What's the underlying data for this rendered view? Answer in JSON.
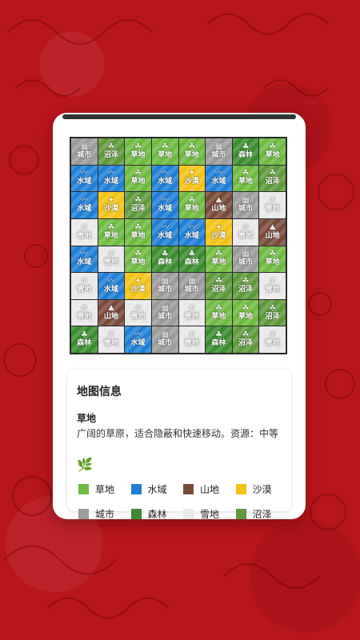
{
  "tile_names": {
    "grass": "草地",
    "water": "水域",
    "mount": "山地",
    "desert": "沙漠",
    "city": "城市",
    "forest": "森林",
    "snow": "雪地",
    "swamp": "沼泽"
  },
  "tile_icons": {
    "grass": "☘",
    "water": "〰",
    "mount": "⛰",
    "desert": "✦",
    "city": "▦",
    "forest": "♣",
    "snow": "❄",
    "swamp": "☘"
  },
  "tile_colors": {
    "grass": "#6fbb3f",
    "water": "#1f7fd6",
    "mount": "#7a4a38",
    "desert": "#f3c314",
    "city": "#9b9b9b",
    "forest": "#3a8d2e",
    "snow": "#e9e9e9",
    "swamp": "#5e9a3a"
  },
  "board": [
    [
      "city",
      "swamp",
      "grass",
      "grass",
      "grass",
      "city",
      "forest",
      "grass"
    ],
    [
      "water",
      "water",
      "grass",
      "water",
      "desert",
      "water",
      "grass",
      "swamp"
    ],
    [
      "water",
      "desert",
      "swamp",
      "water",
      "grass",
      "mount",
      "city",
      "snow"
    ],
    [
      "snow",
      "grass",
      "grass",
      "water",
      "water",
      "desert",
      "snow",
      "mount"
    ],
    [
      "water",
      "snow",
      "grass",
      "forest",
      "forest",
      "grass",
      "city",
      "grass"
    ],
    [
      "snow",
      "water",
      "desert",
      "city",
      "city",
      "swamp",
      "swamp",
      "snow"
    ],
    [
      "snow",
      "mount",
      "snow",
      "city",
      "snow",
      "grass",
      "grass",
      "swamp"
    ],
    [
      "forest",
      "snow",
      "water",
      "city",
      "snow",
      "forest",
      "swamp",
      "snow"
    ]
  ],
  "info": {
    "title": "地图信息",
    "selected_name": "草地",
    "selected_desc": "广阔的草原，适合隐蔽和快速移动。资源：中等",
    "selected_icon": "🌿"
  },
  "legend": [
    {
      "key": "grass",
      "label": "草地",
      "color": "#6fbb3f"
    },
    {
      "key": "water",
      "label": "水域",
      "color": "#1f7fd6"
    },
    {
      "key": "mount",
      "label": "山地",
      "color": "#7a4a38"
    },
    {
      "key": "desert",
      "label": "沙漠",
      "color": "#f3c314"
    },
    {
      "key": "city",
      "label": "城市",
      "color": "#9b9b9b"
    },
    {
      "key": "forest",
      "label": "森林",
      "color": "#3a8d2e"
    },
    {
      "key": "snow",
      "label": "雪地",
      "color": "#e9e9e9"
    },
    {
      "key": "swamp",
      "label": "沼泽",
      "color": "#5e9a3a"
    }
  ]
}
